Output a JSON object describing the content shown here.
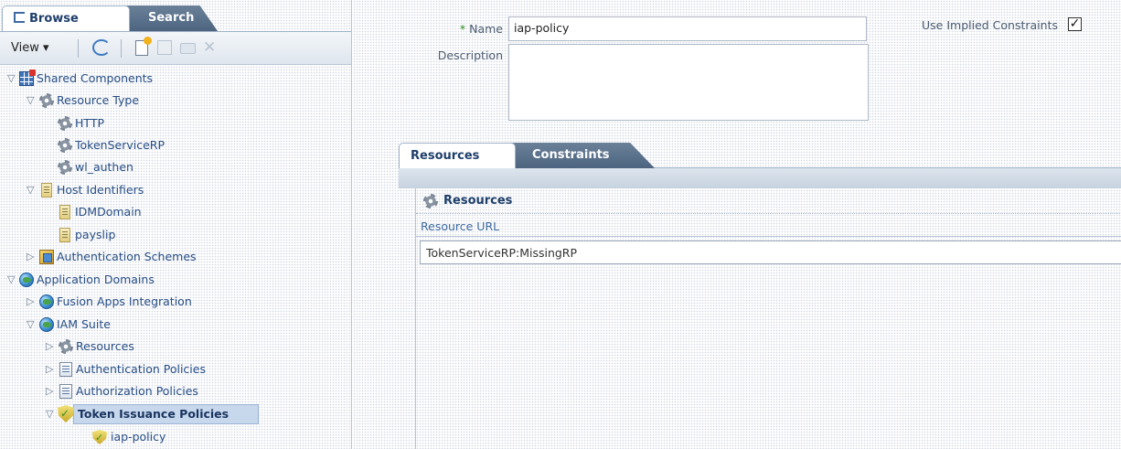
{
  "left_panel": {
    "tabs": {
      "browse": "Browse",
      "search": "Search"
    },
    "toolbar": {
      "view_label": "View ▾"
    },
    "tree": {
      "shared_components": "Shared Components",
      "resource_type": "Resource Type",
      "http": "HTTP",
      "token_service_rp": "TokenServiceRP",
      "wl_authen": "wl_authen",
      "host_identifiers": "Host Identifiers",
      "idm_domain": "IDMDomain",
      "payslip": "payslip",
      "authentication_schemes": "Authentication Schemes",
      "application_domains": "Application Domains",
      "fusion_apps": "Fusion Apps Integration",
      "iam_suite": "IAM Suite",
      "resources": "Resources",
      "authentication_policies": "Authentication Policies",
      "authorization_policies": "Authorization Policies",
      "token_issuance_policies": "Token Issuance Policies",
      "iap_policy": "iap-policy"
    }
  },
  "form": {
    "name_label": "Name",
    "required_marker": "*",
    "name_value": "iap-policy",
    "description_label": "Description",
    "description_value": "",
    "implied_label": "Use Implied Constraints",
    "implied_checked": "✓"
  },
  "tabs": {
    "resources": "Resources",
    "constraints": "Constraints"
  },
  "resources_panel": {
    "title": "Resources",
    "column": "Resource URL",
    "rows": [
      "TokenServiceRP:MissingRP"
    ]
  },
  "colors": {
    "link": "#274e86",
    "tab_dark": "#4d6480",
    "selection": "#c7d7ec"
  }
}
